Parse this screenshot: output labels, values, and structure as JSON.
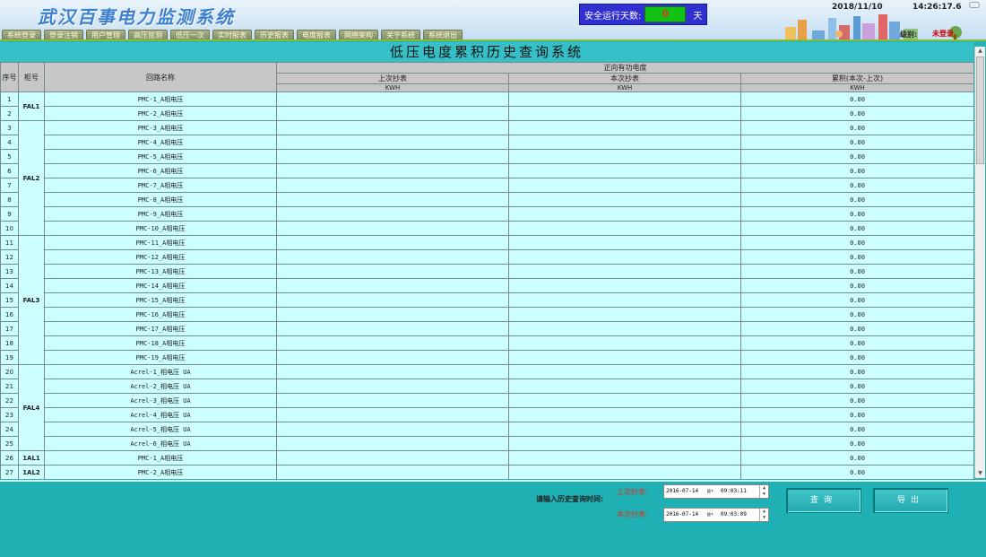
{
  "app": {
    "title": "武汉百事电力监测系统"
  },
  "nav": [
    "系统登录",
    "登录注销",
    "用户管理",
    "高压监测",
    "低压一次",
    "实时报表",
    "历史报表",
    "电度报表",
    "网络架构",
    "关于系统",
    "系统退出"
  ],
  "safety": {
    "label": "安全运行天数:",
    "value": "0",
    "unit": "天"
  },
  "datetime": {
    "date": "2018/11/10",
    "time": "14:26:17.6"
  },
  "user_level": {
    "label": "级别:",
    "value": "未登录"
  },
  "page_title": "低压电度累积历史查询系统",
  "table": {
    "headers": {
      "seq": "序号",
      "cabinet": "柜号",
      "circuit": "回路名称",
      "group": "正向有功电度",
      "last": "上次抄表",
      "current": "本次抄表",
      "accum": "累积(本次-上次)",
      "unit": "KWH"
    },
    "cabinets": [
      {
        "name": "FAL1",
        "rows": [
          {
            "seq": "1",
            "circuit": "PMC-1_A相电压",
            "last": "",
            "current": "",
            "accum": "0.00"
          },
          {
            "seq": "2",
            "circuit": "PMC-2_A相电压",
            "last": "",
            "current": "",
            "accum": "0.00"
          }
        ]
      },
      {
        "name": "FAL2",
        "rows": [
          {
            "seq": "3",
            "circuit": "PMC-3_A相电压",
            "last": "",
            "current": "",
            "accum": "0.00"
          },
          {
            "seq": "4",
            "circuit": "PMC-4_A相电压",
            "last": "",
            "current": "",
            "accum": "0.00"
          },
          {
            "seq": "5",
            "circuit": "PMC-5_A相电压",
            "last": "",
            "current": "",
            "accum": "0.00"
          },
          {
            "seq": "6",
            "circuit": "PMC-6_A相电压",
            "last": "",
            "current": "",
            "accum": "0.00"
          },
          {
            "seq": "7",
            "circuit": "PMC-7_A相电压",
            "last": "",
            "current": "",
            "accum": "0.00"
          },
          {
            "seq": "8",
            "circuit": "PMC-8_A相电压",
            "last": "",
            "current": "",
            "accum": "0.00"
          },
          {
            "seq": "9",
            "circuit": "PMC-9_A相电压",
            "last": "",
            "current": "",
            "accum": "0.00"
          },
          {
            "seq": "10",
            "circuit": "PMC-10_A相电压",
            "last": "",
            "current": "",
            "accum": "0.00"
          }
        ]
      },
      {
        "name": "FAL3",
        "rows": [
          {
            "seq": "11",
            "circuit": "PMC-11_A相电压",
            "last": "",
            "current": "",
            "accum": "0.00"
          },
          {
            "seq": "12",
            "circuit": "PMC-12_A相电压",
            "last": "",
            "current": "",
            "accum": "0.00"
          },
          {
            "seq": "13",
            "circuit": "PMC-13_A相电压",
            "last": "",
            "current": "",
            "accum": "0.00"
          },
          {
            "seq": "14",
            "circuit": "PMC-14_A相电压",
            "last": "",
            "current": "",
            "accum": "0.00"
          },
          {
            "seq": "15",
            "circuit": "PMC-15_A相电压",
            "last": "",
            "current": "",
            "accum": "0.00"
          },
          {
            "seq": "16",
            "circuit": "PMC-16_A相电压",
            "last": "",
            "current": "",
            "accum": "0.00"
          },
          {
            "seq": "17",
            "circuit": "PMC-17_A相电压",
            "last": "",
            "current": "",
            "accum": "0.00"
          },
          {
            "seq": "18",
            "circuit": "PMC-18_A相电压",
            "last": "",
            "current": "",
            "accum": "0.00"
          },
          {
            "seq": "19",
            "circuit": "PMC-19_A相电压",
            "last": "",
            "current": "",
            "accum": "0.00"
          }
        ]
      },
      {
        "name": "FAL4",
        "rows": [
          {
            "seq": "20",
            "circuit": "Acrel-1_相电压 UA",
            "last": "",
            "current": "",
            "accum": "0.00"
          },
          {
            "seq": "21",
            "circuit": "Acrel-2_相电压 UA",
            "last": "",
            "current": "",
            "accum": "0.00"
          },
          {
            "seq": "22",
            "circuit": "Acrel-3_相电压 UA",
            "last": "",
            "current": "",
            "accum": "0.00"
          },
          {
            "seq": "23",
            "circuit": "Acrel-4_相电压 UA",
            "last": "",
            "current": "",
            "accum": "0.00"
          },
          {
            "seq": "24",
            "circuit": "Acrel-5_相电压 UA",
            "last": "",
            "current": "",
            "accum": "0.00"
          },
          {
            "seq": "25",
            "circuit": "Acrel-6_相电压 UA",
            "last": "",
            "current": "",
            "accum": "0.00"
          }
        ]
      },
      {
        "name": "1AL1",
        "rows": [
          {
            "seq": "26",
            "circuit": "PMC-1_A相电压",
            "last": "",
            "current": "",
            "accum": "0.00"
          }
        ]
      },
      {
        "name": "1AL2",
        "rows": [
          {
            "seq": "27",
            "circuit": "PMC-2_A相电压",
            "last": "",
            "current": "",
            "accum": "0.00"
          }
        ]
      }
    ]
  },
  "query": {
    "prompt": "请输入历史查询时间:",
    "last_label": "上次抄表:",
    "last_date": "2016-07-14",
    "last_time": "09:03:11",
    "current_label": "本次抄表:",
    "current_date": "2016-07-14",
    "current_time": "09:03:09",
    "query_button": "查询",
    "export_button": "导出"
  },
  "colors": {
    "background": "#25b3b7",
    "table_row": "#ccffff",
    "accent_red": "#dd3322"
  },
  "icons": [
    "city-skyline-icon",
    "calendar-dropdown-icon",
    "spinner-icon",
    "scroll-up-icon",
    "scroll-down-icon"
  ]
}
